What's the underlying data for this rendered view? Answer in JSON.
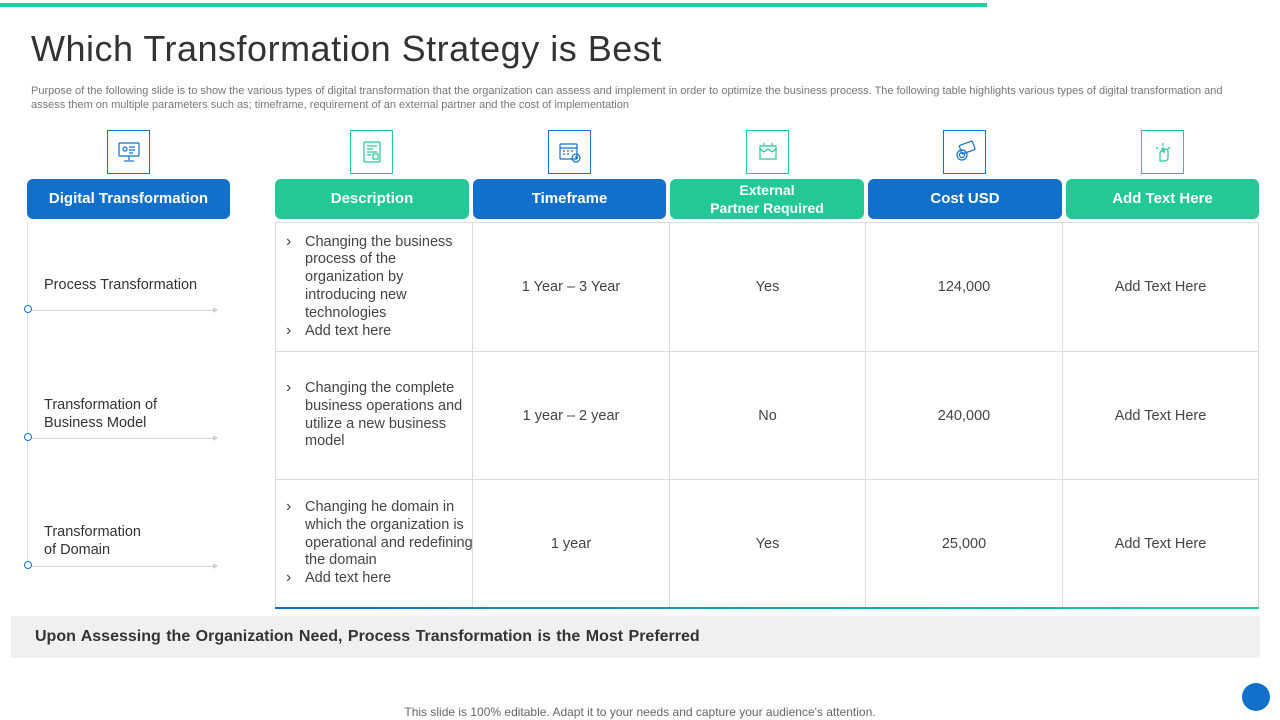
{
  "slide": {
    "title": "Which Transformation Strategy is Best",
    "intro": "Purpose of the following slide is to show the various types of digital transformation that the organization can assess and implement in order to optimize the business process. The following table highlights various types of digital transformation and assess them on multiple parameters such as; timeframe, requirement of an external partner and the cost of implementation"
  },
  "icons": [
    "computer-screen-icon",
    "document-tablet-icon",
    "calendar-clock-icon",
    "partner-handshake-icon",
    "money-coins-icon",
    "hand-touch-icon"
  ],
  "headers": {
    "digital_transformation": "Digital Transformation",
    "description": "Description",
    "timeframe": "Timeframe",
    "external_partner_line1": "External",
    "external_partner_line2": "Partner Required",
    "cost": "Cost USD",
    "add_text": "Add Text Here"
  },
  "rows": [
    {
      "label_line1": "Process Transformation",
      "label_line2": "",
      "description": [
        "Changing the business process of the organization by introducing new technologies",
        "Add text here"
      ],
      "timeframe": "1 Year – 3 Year",
      "external_partner": "Yes",
      "cost": "124,000",
      "add_text": "Add Text Here"
    },
    {
      "label_line1": "Transformation of",
      "label_line2": "Business Model",
      "description": [
        "Changing the complete business operations and utilize a new business model"
      ],
      "timeframe": "1 year – 2 year",
      "external_partner": "No",
      "cost": "240,000",
      "add_text": "Add Text Here"
    },
    {
      "label_line1": "Transformation",
      "label_line2": "of Domain",
      "description": [
        "Changing he domain in which the organization is operational and redefining the domain",
        "Add text here"
      ],
      "timeframe": "1 year",
      "external_partner": "Yes",
      "cost": "25,000",
      "add_text": "Add Text Here"
    }
  ],
  "conclusion": "Upon Assessing the Organization Need, Process Transformation is the Most Preferred",
  "footer": "This slide is 100% editable. Adapt it to your needs and capture your audience's attention.",
  "colors": {
    "blue": "#1270cb",
    "green": "#22c997",
    "accent_bar": "#1ecfa0"
  }
}
